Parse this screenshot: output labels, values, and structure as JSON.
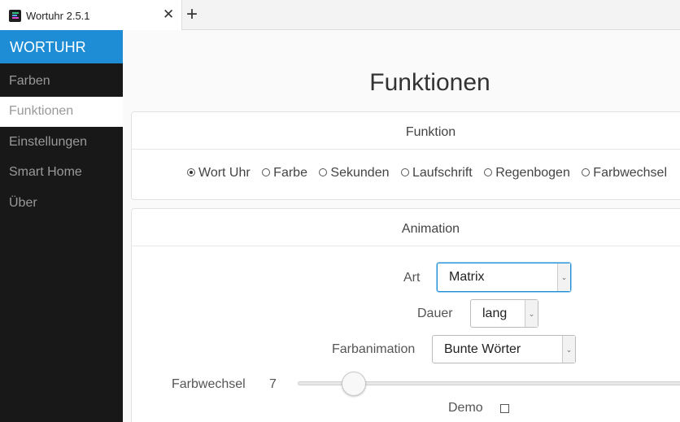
{
  "browser": {
    "tab_title": "Wortuhr 2.5.1",
    "close_symbol": "✕",
    "new_tab_symbol": "+"
  },
  "sidebar": {
    "brand": "WORTUHR",
    "items": [
      {
        "label": "Farben"
      },
      {
        "label": "Funktionen",
        "active": true
      },
      {
        "label": "Einstellungen"
      },
      {
        "label": "Smart Home"
      },
      {
        "label": "Über"
      }
    ]
  },
  "page": {
    "title": "Funktionen"
  },
  "funktion": {
    "title": "Funktion",
    "options": [
      "Wort Uhr",
      "Farbe",
      "Sekunden",
      "Laufschrift",
      "Regenbogen",
      "Farbwechsel"
    ],
    "selected": "Wort Uhr"
  },
  "animation": {
    "title": "Animation",
    "art_label": "Art",
    "art_value": "Matrix",
    "dauer_label": "Dauer",
    "dauer_value": "lang",
    "farbanimation_label": "Farbanimation",
    "farbanimation_value": "Bunte Wörter",
    "farbwechsel_label": "Farbwechsel",
    "farbwechsel_value": "7",
    "demo_label": "Demo",
    "demo_checked": false
  },
  "colors": {
    "accent": "#1f8dd6",
    "sidebar_bg": "#191818"
  }
}
